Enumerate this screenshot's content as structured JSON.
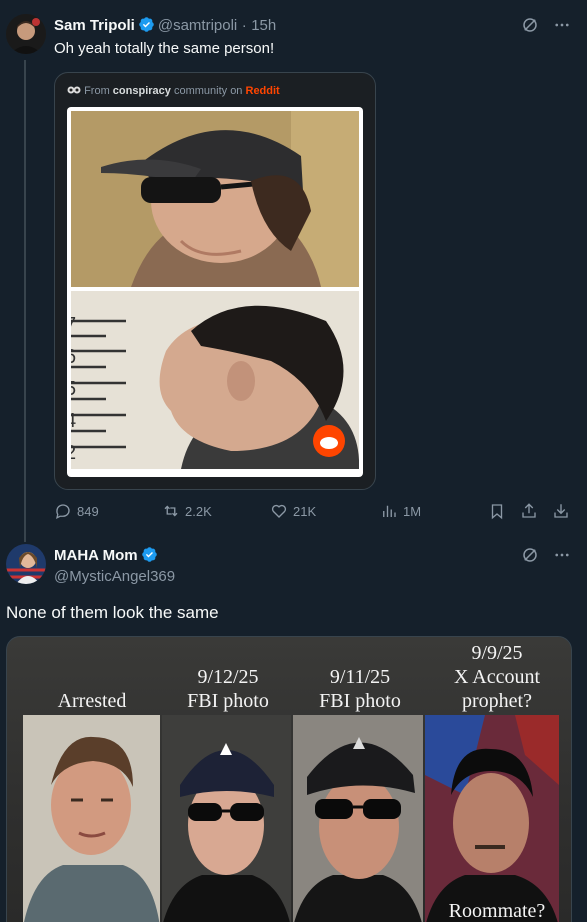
{
  "post1": {
    "display_name": "Sam Tripoli",
    "handle": "@samtripoli",
    "separator": "·",
    "time": "15h",
    "text": "Oh yeah totally the same person!",
    "embed": {
      "from_prefix": "From",
      "community": "conspiracy",
      "community_suffix": "community on",
      "platform": "Reddit"
    },
    "actions": {
      "replies": "849",
      "reposts": "2.2K",
      "likes": "21K",
      "views": "1M"
    },
    "mugshot_marks": [
      "7",
      "6",
      "5",
      "4",
      "2"
    ]
  },
  "post2": {
    "display_name": "MAHA Mom",
    "handle": "@MysticAngel369",
    "text": "None of them look the same",
    "meme": {
      "captions": [
        {
          "line1": "",
          "line2": "Arrested"
        },
        {
          "line1": "9/12/25",
          "line2": "FBI photo"
        },
        {
          "line1": "9/11/25",
          "line2": "FBI photo"
        },
        {
          "line0": "9/9/25",
          "line1": "X Account",
          "line2": "prophet?"
        }
      ],
      "bottom_caption": "Roommate?"
    }
  },
  "icons": [
    "verified-badge-icon",
    "grok-icon",
    "more-icon",
    "reply-icon",
    "repost-icon",
    "like-icon",
    "views-icon",
    "bookmark-icon",
    "share-icon",
    "download-icon",
    "reddit-icon"
  ],
  "colors": {
    "background": "#15202b",
    "verified": "#1d9bf0",
    "muted": "#8b98a5",
    "reddit": "#ff4500"
  }
}
